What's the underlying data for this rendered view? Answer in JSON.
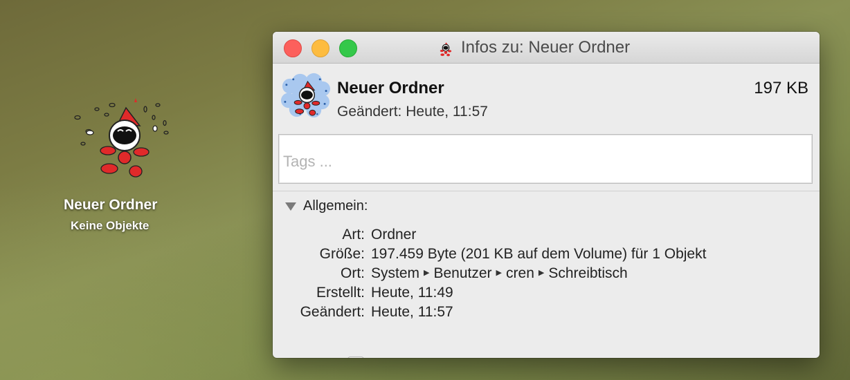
{
  "desktop": {
    "folder_name": "Neuer Ordner",
    "folder_subtitle": "Keine Objekte"
  },
  "window": {
    "title": "Infos zu: Neuer Ordner",
    "header": {
      "name": "Neuer Ordner",
      "size": "197 KB",
      "modified": "Geändert: Heute, 11:57"
    },
    "tags": {
      "placeholder": "Tags ..."
    },
    "section": {
      "label": "Allgemein:",
      "rows": [
        {
          "key": "Art:",
          "value": "Ordner"
        },
        {
          "key": "Größe:",
          "value": "197.459 Byte (201 KB auf dem Volume) für 1 Objekt"
        },
        {
          "key": "Ort:",
          "path": [
            "System",
            "Benutzer",
            "cren",
            "Schreibtisch"
          ]
        },
        {
          "key": "Erstellt:",
          "value": "Heute, 11:49"
        },
        {
          "key": "Geändert:",
          "value": "Heute, 11:57"
        }
      ]
    }
  },
  "icons": [
    "clown-folder-icon",
    "close-button",
    "minimize-button",
    "zoom-button",
    "disclosure-triangle-icon",
    "path-arrow-icon"
  ],
  "colors": {
    "close": "#fc605c",
    "minimize": "#fdbc40",
    "zoom": "#34c84a",
    "clown_red": "#e02a2a",
    "icon_bubble": "#a9c8ef"
  }
}
